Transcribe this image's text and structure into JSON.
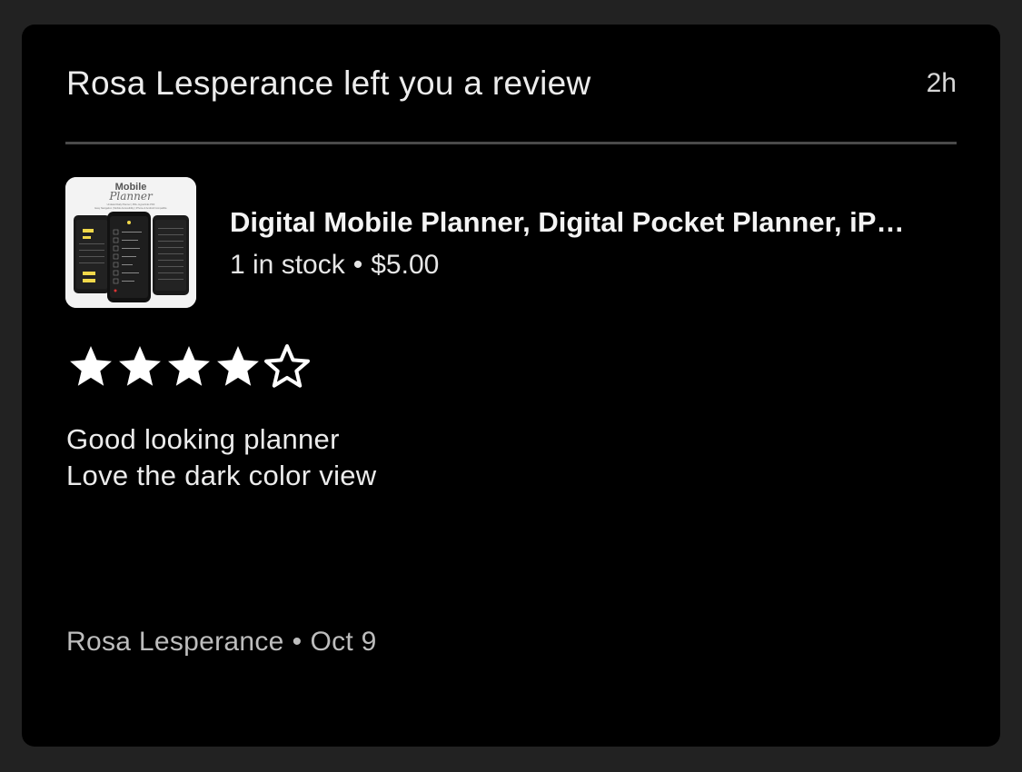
{
  "notification": {
    "title": "Rosa Lesperance left you a review",
    "time": "2h"
  },
  "listing": {
    "title": "Digital Mobile Planner, Digital Pocket Planner, iP…",
    "stock": "1 in stock",
    "separator": "•",
    "price": "$5.00",
    "thumbnail": {
      "heading": "Mobile",
      "script": "Planner",
      "tagline": "Undated Daily Planner | 350+ Hyperlinks PDF",
      "tagline2": "Easy Navigation | Mobile Accessibility | iPhone & Android Compatible"
    }
  },
  "review": {
    "rating": 4,
    "max_rating": 5,
    "lines": [
      "Good looking planner",
      "Love the dark color view"
    ]
  },
  "footer": {
    "author": "Rosa Lesperance",
    "separator": "•",
    "date": "Oct 9"
  },
  "colors": {
    "background": "#222222",
    "card": "#000000",
    "text": "#ececec",
    "muted": "#bdbdbd",
    "thumb_accent": "#f1d84a"
  }
}
